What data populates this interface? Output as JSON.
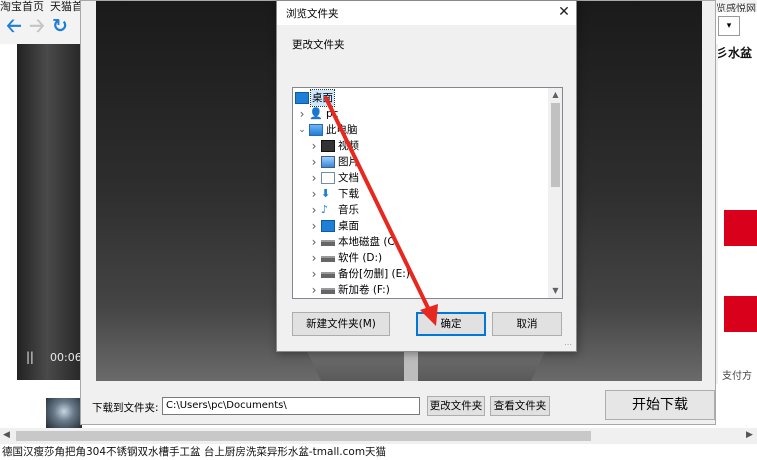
{
  "browser": {
    "tabs": [
      "淘宝首页",
      "天猫首"
    ],
    "right_tab_fragment": "览感悦网",
    "right_product_text": "彡水盆",
    "right_pay_text": "支付方",
    "status_text": "德国汉瘦莎角把角304不锈钢双水槽手工盆 台上厨房洗菜异形水盆-tmall.com天猫",
    "video_time": "00:06",
    "nav_icons": [
      "back-arrow-icon",
      "forward-arrow-icon",
      "refresh-icon"
    ]
  },
  "download_dialog": {
    "folder_label": "下载到文件夹:",
    "folder_path": "C:\\Users\\pc\\Documents\\",
    "change_folder_button": "更改文件夹",
    "view_folder_button": "查看文件夹",
    "start_button": "开始下载"
  },
  "picker": {
    "title": "浏览文件夹",
    "prompt": "更改文件夹",
    "tree": [
      {
        "label": "桌面",
        "icon": "desktop-icon",
        "depth": 0,
        "expander": "",
        "selected": true
      },
      {
        "label": "pc",
        "icon": "user-icon",
        "depth": 1,
        "expander": ">",
        "selected": false
      },
      {
        "label": "此电脑",
        "icon": "computer-icon",
        "depth": 1,
        "expander": "v",
        "selected": false
      },
      {
        "label": "视频",
        "icon": "video-icon",
        "depth": 2,
        "expander": ">",
        "selected": false
      },
      {
        "label": "图片",
        "icon": "picture-icon",
        "depth": 2,
        "expander": ">",
        "selected": false
      },
      {
        "label": "文档",
        "icon": "document-icon",
        "depth": 2,
        "expander": ">",
        "selected": false
      },
      {
        "label": "下载",
        "icon": "download-icon",
        "depth": 2,
        "expander": ">",
        "selected": false
      },
      {
        "label": "音乐",
        "icon": "music-icon",
        "depth": 2,
        "expander": ">",
        "selected": false
      },
      {
        "label": "桌面",
        "icon": "desktop-icon",
        "depth": 2,
        "expander": ">",
        "selected": false
      },
      {
        "label": "本地磁盘 (C",
        "icon": "drive-icon",
        "depth": 2,
        "expander": ">",
        "selected": false
      },
      {
        "label": "软件 (D:)",
        "icon": "drive-icon",
        "depth": 2,
        "expander": ">",
        "selected": false
      },
      {
        "label": "备份[勿删] (E:)",
        "icon": "drive-icon",
        "depth": 2,
        "expander": ">",
        "selected": false
      },
      {
        "label": "新加卷 (F:)",
        "icon": "drive-icon",
        "depth": 2,
        "expander": ">",
        "selected": false
      }
    ],
    "new_folder_button": "新建文件夹(M)",
    "ok_button": "确定",
    "cancel_button": "取消"
  },
  "annotation": {
    "arrow_color": "#e8271f"
  },
  "colors": {
    "accent": "#0078d7",
    "selection": "#cce8ff",
    "brand_red": "#d9001b"
  }
}
